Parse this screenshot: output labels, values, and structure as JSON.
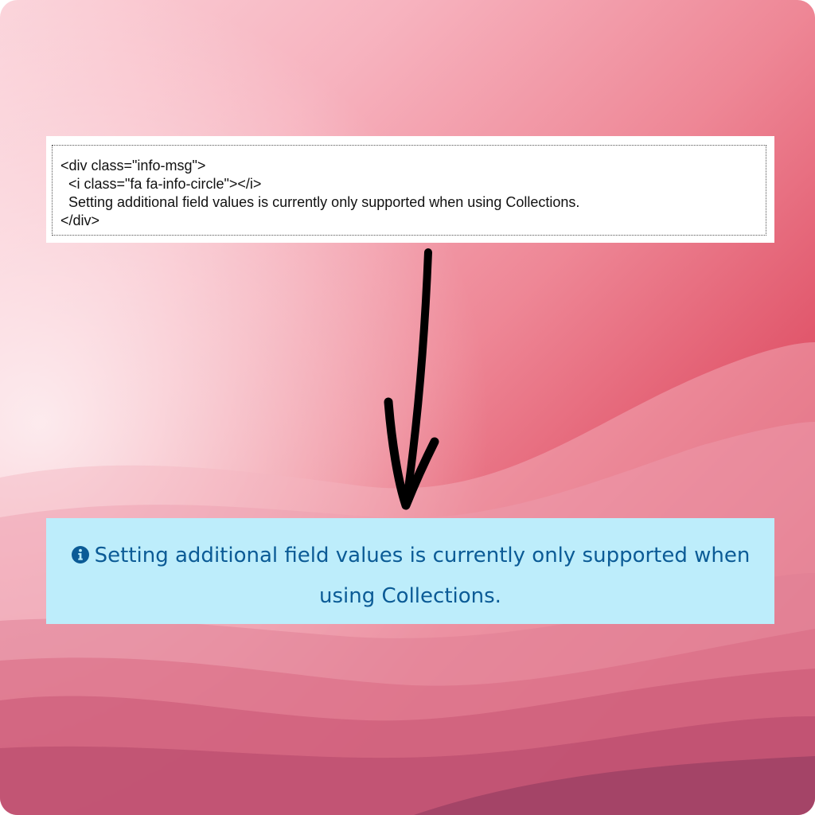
{
  "code_snippet": {
    "lines": [
      "<div class=\"info-msg\">",
      "  <i class=\"fa fa-info-circle\"></i>",
      "  Setting additional field values is currently only supported when using Collections.",
      "</div>"
    ]
  },
  "arrow": {
    "direction": "down",
    "color": "#000000"
  },
  "rendered_message": {
    "icon": "info-circle-icon",
    "text": "Setting additional field values is currently only supported when using Collections.",
    "text_color": "#0b5b96",
    "background_color": "#bdedfb"
  }
}
